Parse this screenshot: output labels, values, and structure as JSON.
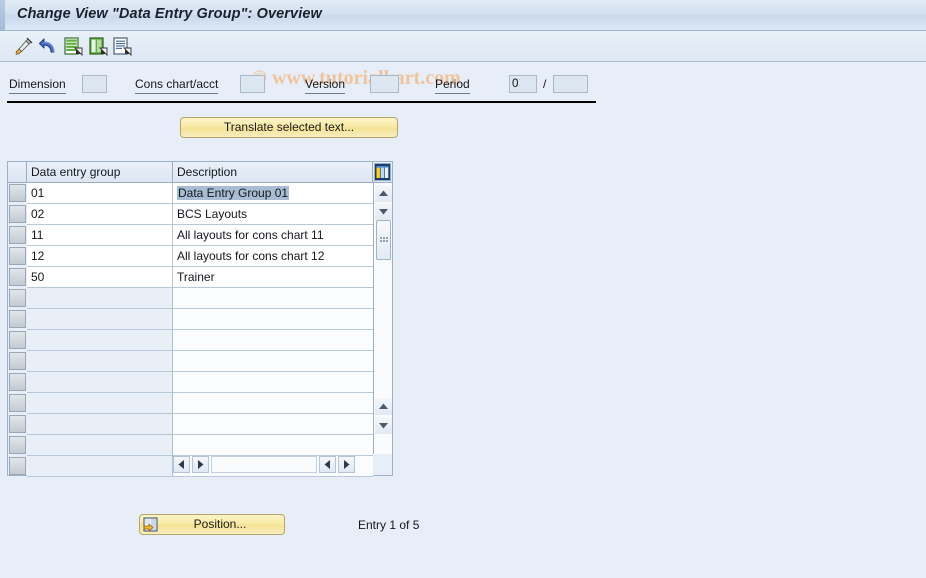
{
  "window": {
    "title": "Change View \"Data Entry Group\": Overview"
  },
  "watermark": {
    "text": "© www.tutorialkart.com",
    "color": "#f0c49b"
  },
  "toolbar": {
    "buttons": [
      {
        "name": "edit-pencil-icon",
        "tooltip": "Display/Change"
      },
      {
        "name": "back-undo-arrow-icon",
        "tooltip": "Undo"
      },
      {
        "name": "new-entries-icon",
        "tooltip": "New Entries"
      },
      {
        "name": "copy-as-icon",
        "tooltip": "Copy As..."
      },
      {
        "name": "details-icon",
        "tooltip": "Details"
      }
    ]
  },
  "filters": {
    "dimension": {
      "label": "Dimension",
      "value": ""
    },
    "cons_chart_acct": {
      "label": "Cons chart/acct",
      "value": ""
    },
    "version": {
      "label": "Version",
      "value": ""
    },
    "period": {
      "label": "Period",
      "value": "0",
      "separator": "/",
      "value2": ""
    }
  },
  "actions": {
    "translate_label": "Translate selected text...",
    "position_label": "Position..."
  },
  "table": {
    "columns": [
      "Data entry group",
      "Description"
    ],
    "rows": [
      {
        "code": "01",
        "description": "Data Entry Group 01",
        "selected": true
      },
      {
        "code": "02",
        "description": "BCS Layouts",
        "selected": false
      },
      {
        "code": "11",
        "description": "All layouts for cons chart 11",
        "selected": false
      },
      {
        "code": "12",
        "description": "All layouts for cons chart 12",
        "selected": false
      },
      {
        "code": "50",
        "description": "Trainer",
        "selected": false
      }
    ],
    "empty_row_count": 9,
    "selection_color": "#a8bdd4"
  },
  "status": {
    "entry_text": "Entry 1 of 5"
  },
  "theme": {
    "background": "#e8eef7",
    "titlebar_start": "#e2ebf6",
    "titlebar_end": "#dce7f4",
    "button_yellow": "#f3e291",
    "border": "#9db2c8"
  }
}
